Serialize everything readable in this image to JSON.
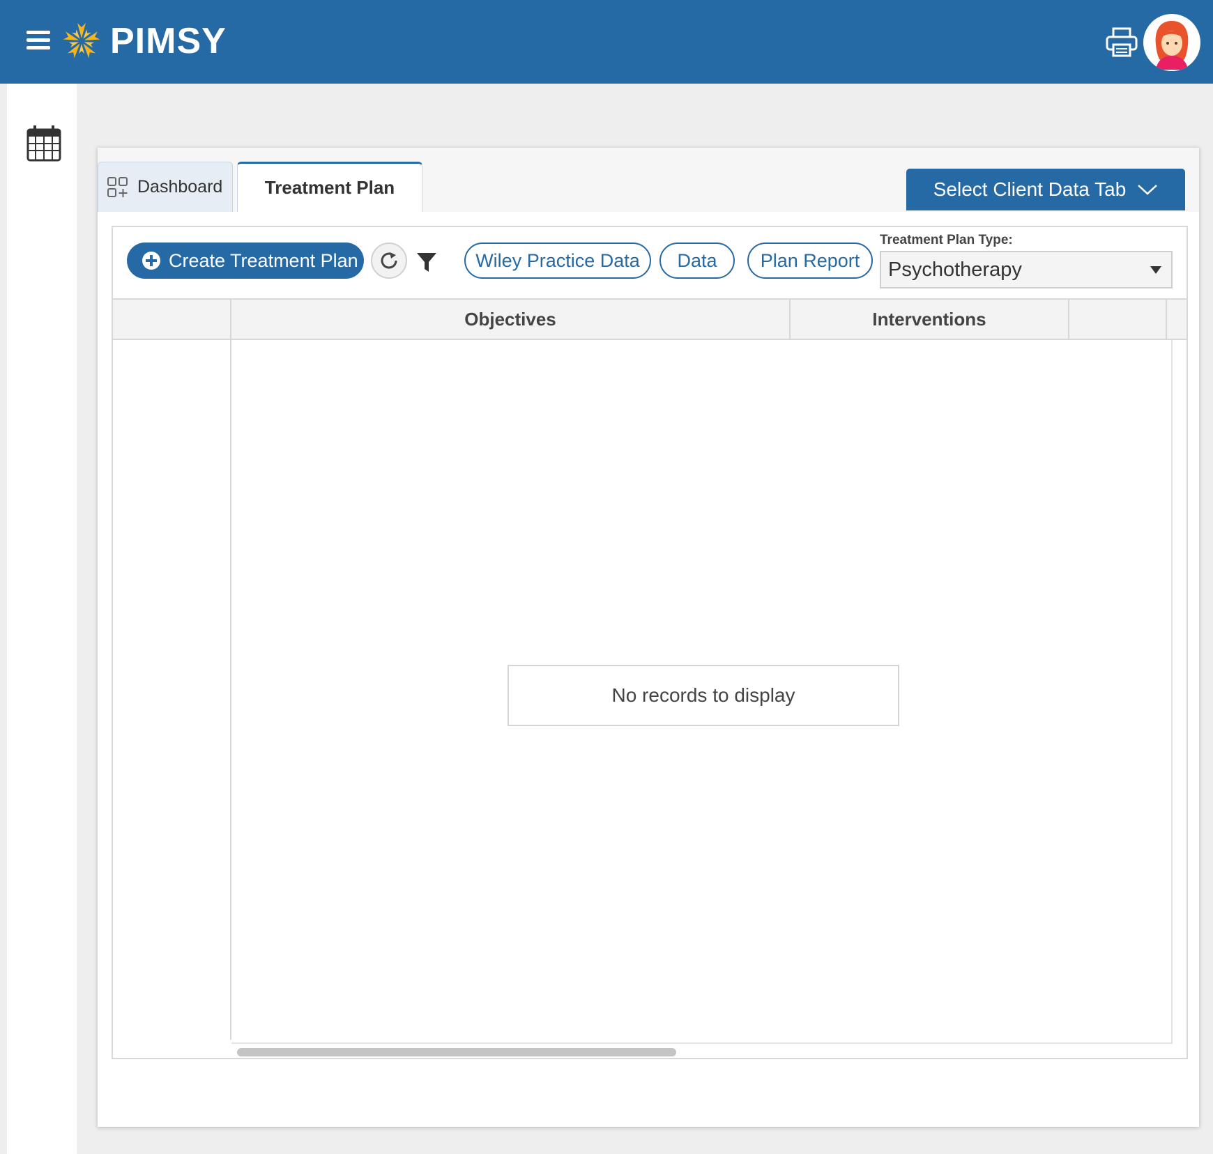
{
  "header": {
    "brand": "PIMSY",
    "menu_icon": "hamburger-menu-icon",
    "logo_icon": "pimsy-flower-logo",
    "print_icon": "printer-icon",
    "avatar_icon": "user-avatar"
  },
  "sidebar": {
    "calendar_icon": "calendar-icon"
  },
  "tabs": [
    {
      "label": "Dashboard",
      "icon": "dashboard-grid-icon",
      "active": false
    },
    {
      "label": "Treatment Plan",
      "active": true
    }
  ],
  "select_client_tab": {
    "label": "Select Client Data Tab",
    "icon": "chevron-down-icon"
  },
  "toolbar": {
    "create_label": "Create Treatment Plan",
    "refresh_icon": "refresh-icon",
    "filter_icon": "filter-icon",
    "wiley_label": "Wiley Practice Data",
    "data_label": "Data",
    "plan_report_label": "Plan Report",
    "type_label": "Treatment Plan Type:",
    "type_value": "Psychotherapy"
  },
  "grid": {
    "columns": [
      "",
      "Objectives",
      "Interventions",
      ""
    ],
    "empty_message": "No records to display"
  },
  "colors": {
    "primary": "#2569a5",
    "logo_yellow": "#f5b51b",
    "avatar_hair": "#e8532b"
  }
}
